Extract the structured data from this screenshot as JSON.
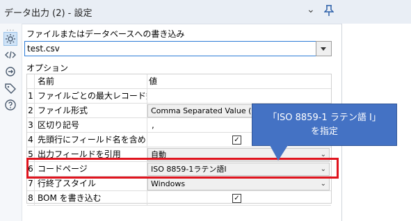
{
  "titlebar": {
    "title": "データ出力 (2) - 設定",
    "chevron_icon": "chevron-down-icon",
    "pin_icon": "pin-icon"
  },
  "sidebar": {
    "dots": "...",
    "icons": [
      "settings-icon",
      "code-icon",
      "connections-icon",
      "tag-icon",
      "help-icon"
    ]
  },
  "form": {
    "write_label": "ファイルまたはデータベースへの書き込み",
    "file_value": "test.csv",
    "options_label": "オプション"
  },
  "table": {
    "headers": {
      "name": "名前",
      "value": "値"
    },
    "rows": [
      {
        "num": "1",
        "name": "ファイルごとの最大レコード数",
        "value": ""
      },
      {
        "num": "2",
        "name": "ファイル形式",
        "value": "Comma Separated Value (*.csv)"
      },
      {
        "num": "3",
        "name": "区切り記号",
        "value": ","
      },
      {
        "num": "4",
        "name": "先頭行にフィールド名を含め...",
        "value": ""
      },
      {
        "num": "5",
        "name": "出力フィールドを引用",
        "value": "自動"
      },
      {
        "num": "6",
        "name": "コードページ",
        "value": "ISO 8859-1ラテン語I"
      },
      {
        "num": "7",
        "name": "行終了スタイル",
        "value": "Windows"
      },
      {
        "num": "8",
        "name": "BOM を書き込む",
        "value": ""
      }
    ]
  },
  "callout": {
    "line1": "「ISO 8859-1 ラテン語 I」",
    "line2": "を指定"
  },
  "colors": {
    "highlight": "#e0141e",
    "callout_bg": "#4472c4",
    "accent": "#2b7bd6"
  }
}
